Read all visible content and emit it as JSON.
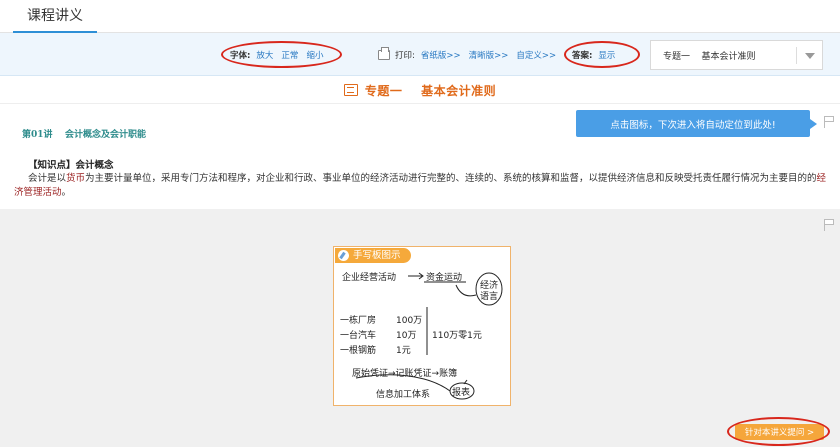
{
  "tabs": {
    "active_label": "课程讲义"
  },
  "toolbar": {
    "font_label": "字体:",
    "font_options": [
      "放大",
      "正常",
      "缩小"
    ],
    "print_label": "打印:",
    "print_options": [
      "省纸版>>",
      "清晰版>>",
      "自定义>>"
    ],
    "answer_label": "答案:",
    "answer_value": "显示",
    "topic_select": {
      "value": "专题一    基本会计准则"
    }
  },
  "title": "专题一    基本会计准则",
  "lecture_heading": "第01讲    会计概念及会计职能",
  "tooltip": "点击图标，下次进入将自动定位到此处!",
  "knowledge_point": {
    "title": "【知识点】会计概念",
    "body_parts": [
      "会计是以",
      "货币",
      "为主要计量单位，采用专门方法和程序，对企业和行政、事业单位的经济活动进行完整的、连续的、系统的核算和监督，以提供经济信息和反映受托责任履行情况为主要目的的",
      "经济管理活动",
      "。"
    ]
  },
  "handwriting_board": {
    "header": "手写板图示",
    "lines": [
      "企业经营活动",
      "资金运动",
      "经济",
      "语言",
      "一栋厂房",
      "100万",
      "一台汽车",
      "10万",
      "一根钢筋",
      "1元",
      "110万零1元",
      "原始凭证→记账凭证→账簿",
      "信息加工体系",
      "报表"
    ]
  },
  "ask_button": "针对本讲义提问 >",
  "colors": {
    "accent_blue": "#2e8fd6",
    "title_orange": "#e06a1b",
    "annotation_red": "#d8271c",
    "button_orange": "#f5a63b"
  }
}
